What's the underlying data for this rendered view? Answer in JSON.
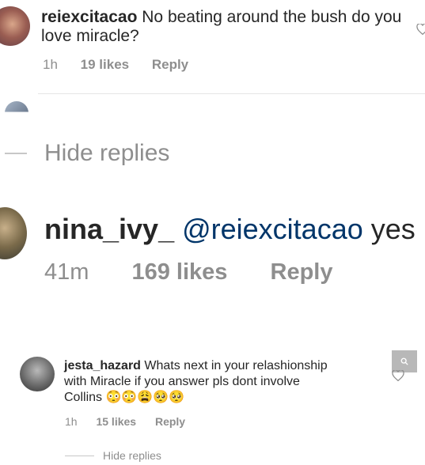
{
  "comments": [
    {
      "username": "reiexcitacao",
      "text": "No beating around the bush do you love miracle?",
      "time": "1h",
      "likes": "19 likes",
      "reply_label": "Reply"
    },
    {
      "username": "nina_ivy_",
      "mention": "@reiexcitacao",
      "text": "yes",
      "time": "41m",
      "likes": "169 likes",
      "reply_label": "Reply"
    },
    {
      "username": "jesta_hazard",
      "text_line1": "Whats next in your relashionship",
      "text_line2": "with Miracle if you answer pls dont involve",
      "text_line3": "Collins",
      "emojis": "😳😳😩🥺🥺",
      "time": "1h",
      "likes": "15 likes",
      "reply_label": "Reply"
    }
  ],
  "hide_replies_label": "Hide replies",
  "hide_replies_label_bottom": "Hide replies",
  "colors": {
    "mention": "#003569",
    "meta": "#8e8e8e",
    "text": "#262626",
    "search_box": "#b8b8b8"
  },
  "icons": [
    "heart-icon",
    "search-icon"
  ]
}
